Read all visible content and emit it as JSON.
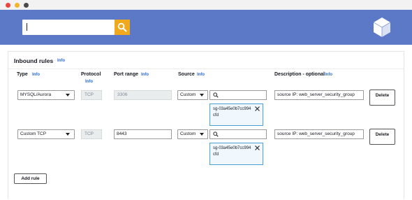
{
  "search": {
    "value": "",
    "placeholder": ""
  },
  "panel": {
    "title": "Inbound rules",
    "info": "Info"
  },
  "columns": {
    "type": {
      "label": "Type",
      "info": "Info"
    },
    "protocol": {
      "label": "Protocol",
      "info": "Info"
    },
    "port_range": {
      "label": "Port range",
      "info": "Info"
    },
    "source": {
      "label": "Source",
      "info": "Info"
    },
    "description": {
      "label": "Description - optional",
      "info": "Info"
    }
  },
  "rules": [
    {
      "type": "MYSQL/Aurora",
      "protocol": "TCP",
      "port_range": "3306",
      "source_mode": "Custom",
      "source_search": "",
      "source_token": "sg-03a45e0b7cc994cfd",
      "description": "source IP: web_server_security_group",
      "delete_label": "Delete"
    },
    {
      "type": "Custom TCP",
      "protocol": "TCP",
      "port_range": "8443",
      "source_mode": "Custom",
      "source_search": "",
      "source_token": "sg-03a45e0b7cc994cfd",
      "description": "source IP: web_server_security_group",
      "delete_label": "Delete"
    }
  ],
  "add_rule_label": "Add rule",
  "colors": {
    "header": "#5b79c6",
    "search_button": "#f0a81c",
    "info_link": "#2b6cd4",
    "token_border": "#4aa1d8"
  },
  "icons": {
    "search_button": "search-icon",
    "logo": "cube-icon",
    "source_search": "search-icon",
    "token_remove": "close-icon",
    "dropdown": "caret-down-icon"
  }
}
